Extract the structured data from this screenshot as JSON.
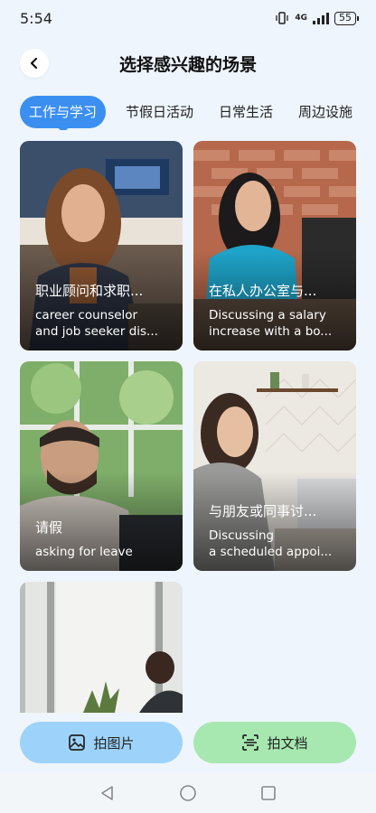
{
  "status": {
    "time": "5:54",
    "network": "4G",
    "battery": "55"
  },
  "header": {
    "title": "选择感兴趣的场景"
  },
  "tabs": [
    {
      "label": "工作与学习",
      "active": true
    },
    {
      "label": "节假日活动",
      "active": false
    },
    {
      "label": "日常生活",
      "active": false
    },
    {
      "label": "周边设施",
      "active": false
    }
  ],
  "cards": [
    {
      "title": "职业顾问和求职...",
      "sub1": "career counselor",
      "sub2": "and job seeker dis..."
    },
    {
      "title": "在私人办公室与...",
      "sub1": "Discussing a salary",
      "sub2": "increase with a bo..."
    },
    {
      "title": "请假",
      "sub1": "asking for leave",
      "sub2": ""
    },
    {
      "title": "与朋友或同事讨...",
      "sub1": "Discussing",
      "sub2": "a scheduled appoi..."
    }
  ],
  "actions": {
    "photo_label": "拍图片",
    "doc_label": "拍文档"
  },
  "colors": {
    "accent": "#3b8ff0",
    "photo_button": "#9dd3fb",
    "doc_button": "#a6e8b0"
  }
}
